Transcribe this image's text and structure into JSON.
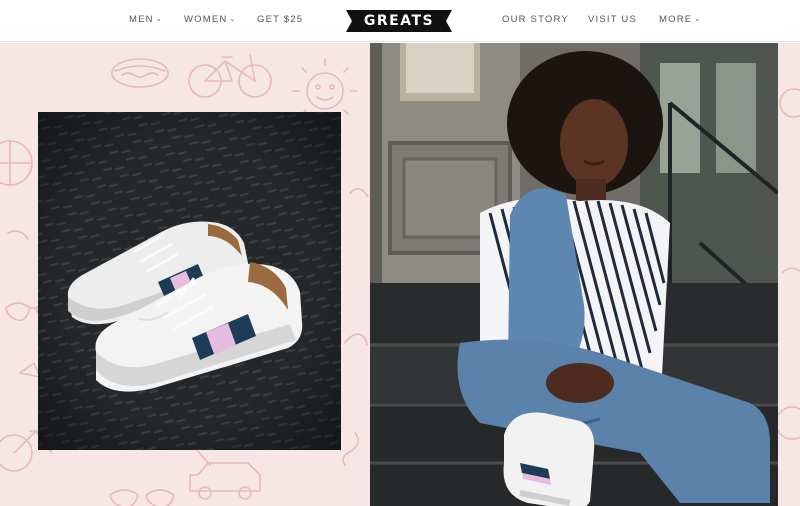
{
  "nav": {
    "left": [
      {
        "label": "MEN",
        "dropdown": true
      },
      {
        "label": "WOMEN",
        "dropdown": true
      },
      {
        "label": "GET $25",
        "dropdown": false
      }
    ],
    "right": [
      {
        "label": "OUR STORY",
        "dropdown": false
      },
      {
        "label": "VISIT US",
        "dropdown": false
      },
      {
        "label": "MORE",
        "dropdown": true
      }
    ]
  },
  "logo": {
    "text": "GREATS"
  },
  "colors": {
    "pattern_bg": "#f6e6e6",
    "pattern_line": "#e9b8b8",
    "stripe_navy": "#1e3b57",
    "stripe_pink": "#e6bde0",
    "logo_bg": "#111111"
  }
}
